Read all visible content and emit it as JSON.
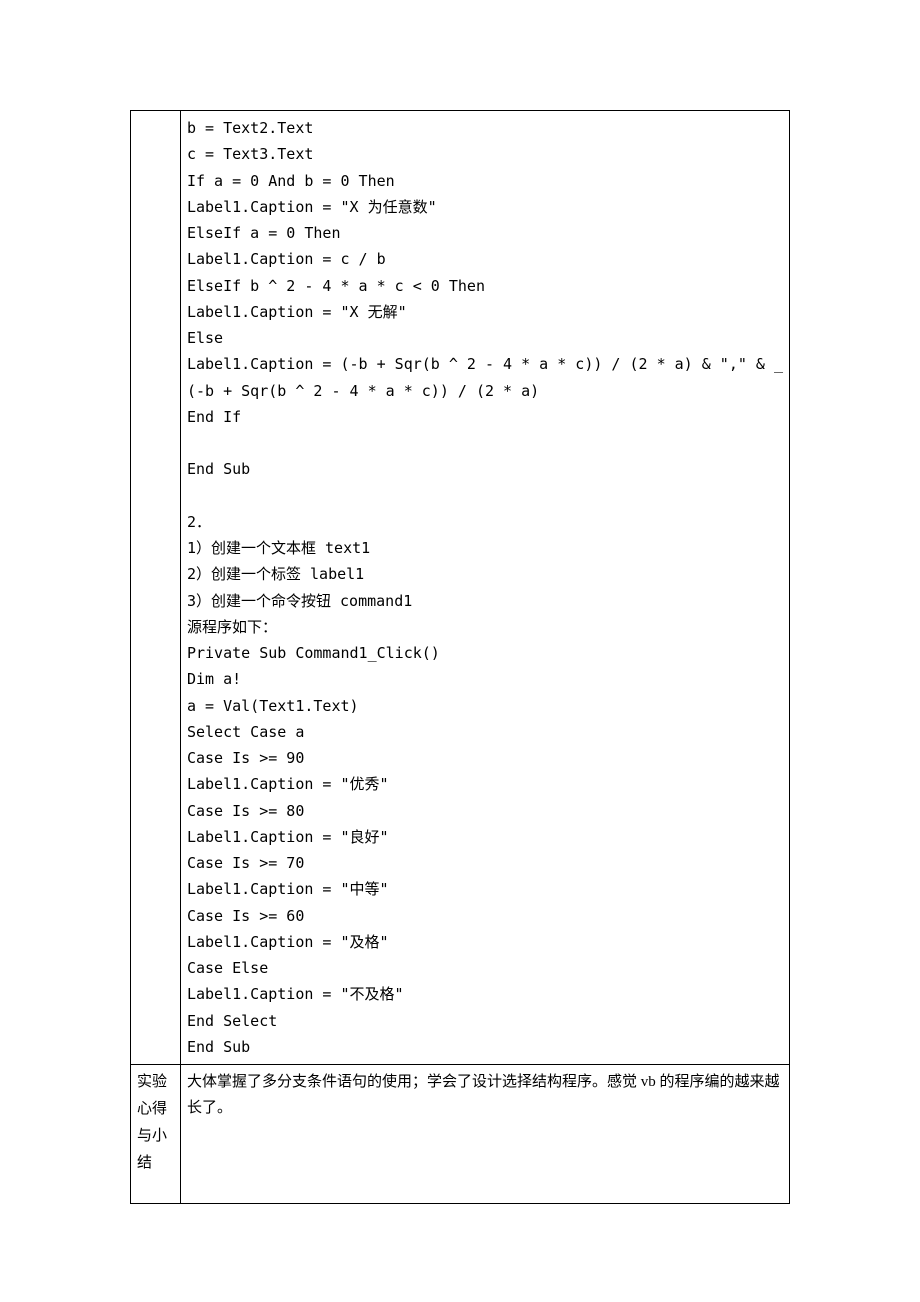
{
  "row1": {
    "label": "",
    "code": [
      "b = Text2.Text",
      "c = Text3.Text",
      "If a = 0 And b = 0 Then",
      "Label1.Caption = \"X 为任意数\"",
      "ElseIf a = 0 Then",
      "Label1.Caption = c / b",
      "ElseIf b ^ 2 - 4 * a * c < 0 Then",
      "Label1.Caption = \"X 无解\"",
      "Else",
      "Label1.Caption = (-b + Sqr(b ^ 2 - 4 * a * c)) / (2 * a) & \",\" & _",
      "(-b + Sqr(b ^ 2 - 4 * a * c)) / (2 * a)",
      "End If",
      "",
      "End Sub",
      "",
      "2．",
      "1）创建一个文本框 text1",
      "2）创建一个标签 label1",
      "3）创建一个命令按钮 command1",
      "源程序如下：",
      "Private Sub Command1_Click()",
      "Dim a!",
      "a = Val(Text1.Text)",
      "Select Case a",
      "Case Is >= 90",
      "Label1.Caption = \"优秀\"",
      "Case Is >= 80",
      "Label1.Caption = \"良好\"",
      "Case Is >= 70",
      "Label1.Caption = \"中等\"",
      "Case Is >= 60",
      "Label1.Caption = \"及格\"",
      "Case Else",
      "Label1.Caption = \"不及格\"",
      "End Select",
      "End Sub"
    ]
  },
  "row2": {
    "label": "实验心得与小结",
    "text": "大体掌握了多分支条件语句的使用；学会了设计选择结构程序。感觉 vb 的程序编的越来越长了。"
  }
}
